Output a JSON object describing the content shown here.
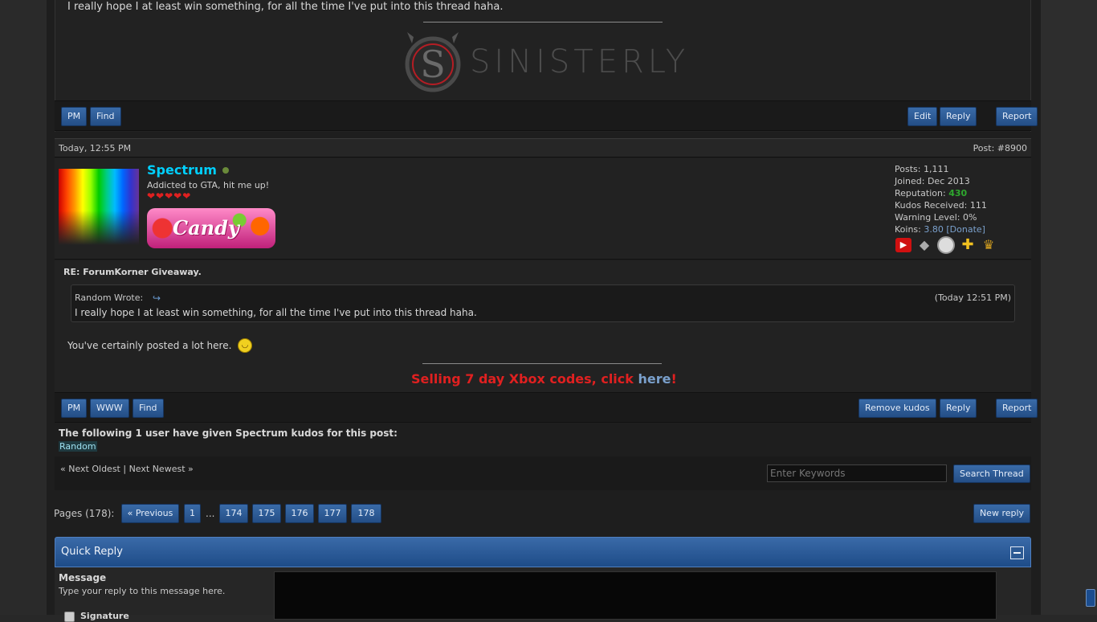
{
  "prev_post": {
    "quote_text": "I really hope I at least win something, for all the time I've put into this thread haha.",
    "signature_logo_text": "SINISTERLY",
    "buttons_left": [
      "PM",
      "Find"
    ],
    "buttons_right": [
      "Edit",
      "Reply",
      "Report"
    ]
  },
  "post": {
    "date": "Today, 12:55 PM",
    "number": "Post: #8900",
    "username": "Spectrum",
    "usertitle": "Addicted to GTA, hit me up!",
    "hearts": "❤❤❤❤❤",
    "userbar_text": "Candy",
    "stats": {
      "posts": "Posts: 1,111",
      "joined": "Joined: Dec 2013",
      "reputation_label": "Reputation: ",
      "reputation_value": "430",
      "kudos": "Kudos Received: 111",
      "warning": "Warning Level: 0%",
      "koins_label": "Koins: ",
      "koins_value": "3.80",
      "donate": "[Donate]"
    },
    "subject": "RE: ForumKorner Giveaway.",
    "quote": {
      "author": "Random Wrote:",
      "time": "(Today 12:51 PM)",
      "text": "I really hope I at least win something, for all the time I've put into this thread haha."
    },
    "message": "You've certainly posted a lot here.",
    "sig_text": "Selling 7 day Xbox codes, click ",
    "sig_link": "here",
    "sig_end": "!",
    "buttons_left": [
      "PM",
      "WWW",
      "Find"
    ],
    "buttons_right": [
      "Remove kudos",
      "Reply",
      "Report"
    ]
  },
  "kudos": {
    "heading": "The following 1 user have given Spectrum kudos for this post:",
    "user": "Random"
  },
  "thread_nav": {
    "next_oldest": "« Next Oldest",
    "separator": "|",
    "next_newest": "Next Newest »",
    "search_placeholder": "Enter Keywords",
    "search_button": "Search Thread"
  },
  "pagination": {
    "label": "Pages (178):",
    "previous": "« Previous",
    "pages": [
      "1",
      "174",
      "175",
      "176",
      "177",
      "178"
    ],
    "ellipsis": "...",
    "new_reply": "New reply"
  },
  "quick_reply": {
    "title": "Quick Reply",
    "message_label": "Message",
    "message_hint": "Type your reply to this message here.",
    "signature_option": "Signature"
  },
  "colors": {
    "username": "#00d0ff",
    "reputation": "#2ea82e",
    "link": "#7aa0cc",
    "sig_red": "#e02020",
    "button": "#2c5a94"
  }
}
